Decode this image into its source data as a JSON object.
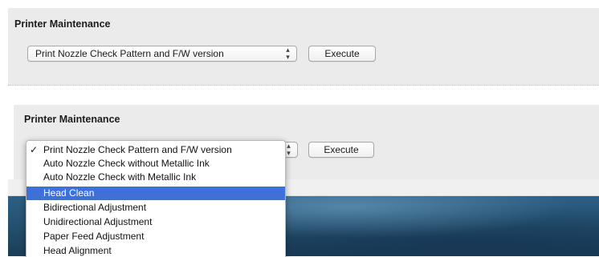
{
  "panel_top": {
    "title": "Printer Maintenance",
    "select_value": "Print Nozzle Check Pattern and F/W version",
    "execute_label": "Execute"
  },
  "panel_bottom": {
    "title": "Printer Maintenance",
    "execute_label": "Execute"
  },
  "menu": {
    "items": [
      {
        "label": "Print Nozzle Check Pattern and F/W version",
        "checked": true
      },
      {
        "label": "Auto Nozzle Check without Metallic Ink"
      },
      {
        "label": "Auto Nozzle Check with Metallic Ink"
      },
      {
        "label": "Head Clean",
        "highlighted": true
      },
      {
        "label": "Bidirectional Adjustment"
      },
      {
        "label": "Unidirectional Adjustment"
      },
      {
        "label": "Paper Feed Adjustment"
      },
      {
        "label": "Head Alignment"
      }
    ],
    "check_glyph": "✓"
  },
  "colors": {
    "highlight": "#3e70d8",
    "panel_bg": "#ebebeb"
  }
}
